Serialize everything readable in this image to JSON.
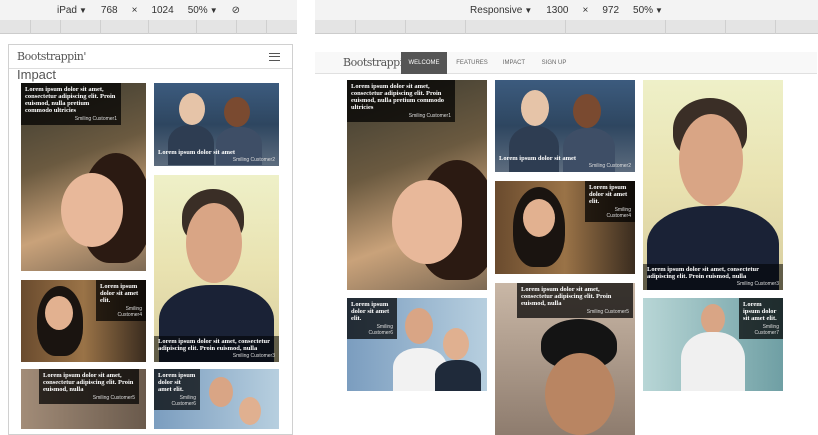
{
  "devtools_left": {
    "device": "iPad",
    "width": "768",
    "times": "×",
    "height": "1024",
    "zoom": "50%"
  },
  "devtools_right": {
    "device": "Responsive",
    "width": "1300",
    "times": "×",
    "height": "972",
    "zoom": "50%"
  },
  "brand": "Bootstrappin'",
  "left_page": {
    "heading": "Impact"
  },
  "nav": {
    "items": [
      {
        "label": "WELCOME"
      },
      {
        "label": "FEATURES"
      },
      {
        "label": "IMPACT"
      },
      {
        "label": "SIGN UP"
      }
    ]
  },
  "captions": {
    "long": "Lorem ipsum dolor sit amet, consectetur adipiscing elit. Proin euismod, nulla pretium commodo ultricies",
    "medium": "Lorem ipsum dolor sit amet, consectetur adipiscing elit. Proin euismod, nulla",
    "short": "Lorem ipsum dolor sit amet",
    "short_elit": "Lorem ipsum dolor sit amet elit.",
    "c1": "Smiling Customer1",
    "c2": "Smiling Customer2",
    "c3": "Smiling Customer3",
    "c4": "Smiling Customer4",
    "c5": "Smiling Customer5",
    "c6": "Smiling Customer6",
    "c7": "Smiling Customer7"
  },
  "colors": {
    "overlay": "#000000",
    "nav_active": "#555555"
  }
}
